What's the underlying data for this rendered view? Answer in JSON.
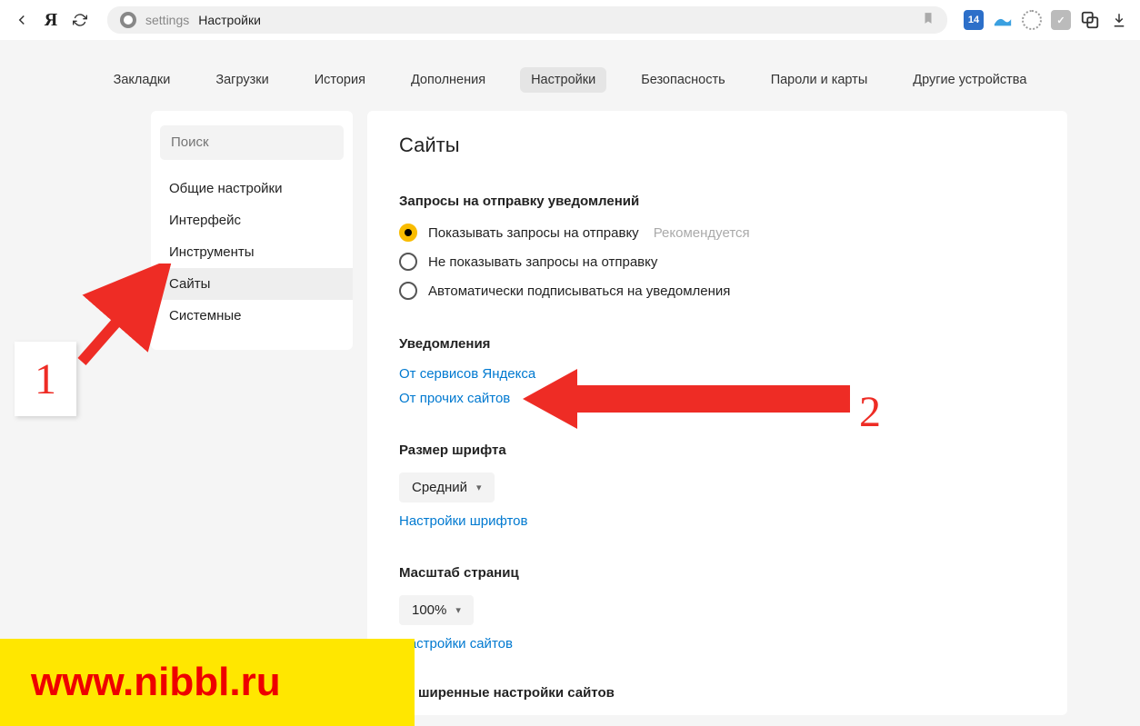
{
  "toolbar": {
    "address_prefix": "settings",
    "address_title": "Настройки"
  },
  "tabs": {
    "items": [
      "Закладки",
      "Загрузки",
      "История",
      "Дополнения",
      "Настройки",
      "Безопасность",
      "Пароли и карты",
      "Другие устройства"
    ],
    "active_index": 4
  },
  "sidebar": {
    "search_placeholder": "Поиск",
    "items": [
      "Общие настройки",
      "Интерфейс",
      "Инструменты",
      "Сайты",
      "Системные"
    ],
    "active_index": 3
  },
  "panel": {
    "title": "Сайты",
    "notif_req": {
      "title": "Запросы на отправку уведомлений",
      "opt1": "Показывать запросы на отправку",
      "opt1_reco": "Рекомендуется",
      "opt2": "Не показывать запросы на отправку",
      "opt3": "Автоматически подписываться на уведомления"
    },
    "notif": {
      "title": "Уведомления",
      "link1": "От сервисов Яндекса",
      "link2": "От прочих сайтов"
    },
    "font": {
      "title": "Размер шрифта",
      "value": "Средний",
      "link": "Настройки шрифтов"
    },
    "zoom": {
      "title": "Масштаб страниц",
      "value": "100%",
      "link": "Настройки сайтов"
    },
    "advanced_partial": "ширенные настройки сайтов"
  },
  "annotations": {
    "num1": "1",
    "num2": "2",
    "watermark": "www.nibbl.ru"
  }
}
